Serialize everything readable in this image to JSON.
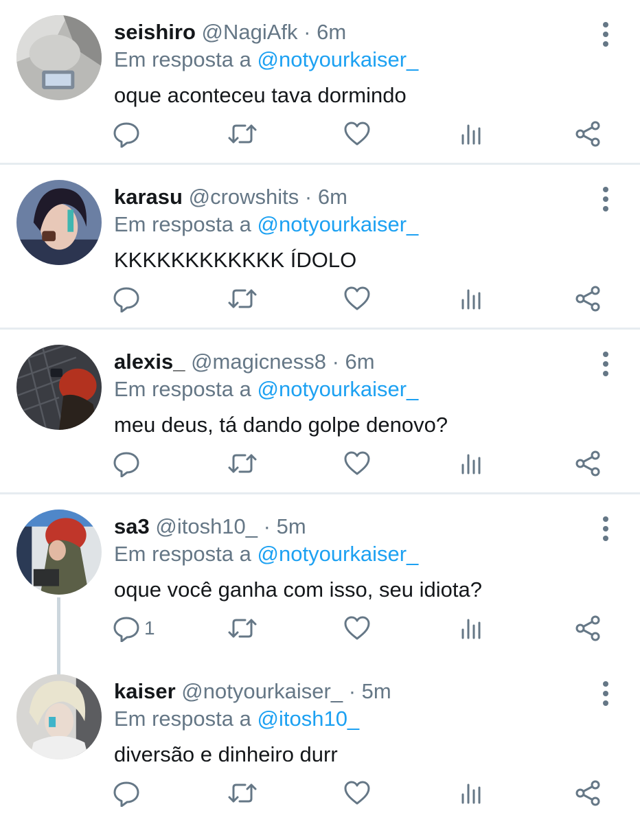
{
  "reply_prefix": "Em resposta a",
  "dot": "·",
  "colors": {
    "name": "#14171a",
    "muted": "#657786",
    "link": "#1da1f2",
    "divider": "#e6ecf0"
  },
  "icons": [
    "more-vertical-icon",
    "reply-icon",
    "retweet-icon",
    "like-icon",
    "analytics-icon",
    "share-icon"
  ],
  "tweets": [
    {
      "name": "seishiro",
      "handle": "@NagiAfk",
      "time": "6m",
      "reply_to": "@notyourkaiser_",
      "text": "oque aconteceu tava dormindo",
      "reply_count": ""
    },
    {
      "name": "karasu",
      "handle": "@crowshits",
      "time": "6m",
      "reply_to": "@notyourkaiser_",
      "text": "KKKKKKKKKKKK ÍDOLO",
      "reply_count": ""
    },
    {
      "name": "alexis_",
      "handle": "@magicness8",
      "time": "6m",
      "reply_to": "@notyourkaiser_",
      "text": "meu deus, tá dando golpe denovo?",
      "reply_count": ""
    },
    {
      "name": "sa3",
      "handle": "@itosh10_",
      "time": "5m",
      "reply_to": "@notyourkaiser_",
      "text": "oque você ganha com isso, seu idiota?",
      "reply_count": "1"
    },
    {
      "name": "kaiser",
      "handle": "@notyourkaiser_",
      "time": "5m",
      "reply_to": "@itosh10_",
      "text": "diversão e dinheiro durr",
      "reply_count": ""
    }
  ]
}
